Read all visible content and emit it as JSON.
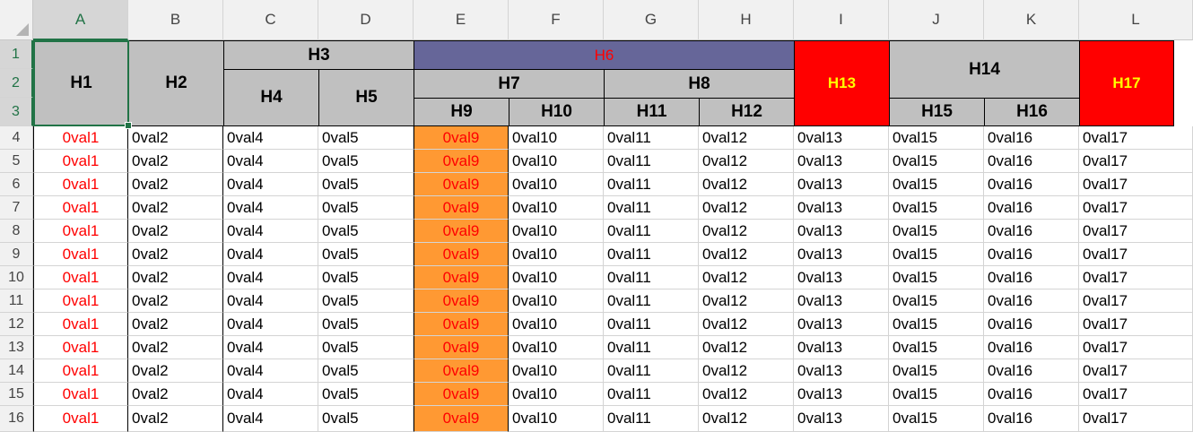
{
  "sheet": {
    "columns": [
      "A",
      "B",
      "C",
      "D",
      "E",
      "F",
      "G",
      "H",
      "I",
      "J",
      "K",
      "L"
    ],
    "rows": [
      "1",
      "2",
      "3",
      "4",
      "5",
      "6",
      "7",
      "8",
      "9",
      "10",
      "11",
      "12",
      "13",
      "14",
      "15",
      "16"
    ],
    "selected_column": "A",
    "selected_rows": [
      "1",
      "2",
      "3"
    ]
  },
  "headers": {
    "h1": "H1",
    "h2": "H2",
    "h3": "H3",
    "h4": "H4",
    "h5": "H5",
    "h6": "H6",
    "h7": "H7",
    "h8": "H8",
    "h9": "H9",
    "h10": "H10",
    "h11": "H11",
    "h12": "H12",
    "h13": "H13",
    "h14": "H14",
    "h15": "H15",
    "h16": "H16",
    "h17": "H17"
  },
  "data_row": [
    "0val1",
    "0val2",
    "0val4",
    "0val5",
    "0val9",
    "0val10",
    "0val11",
    "0val12",
    "0val13",
    "0val15",
    "0val16",
    "0val17"
  ],
  "colors": {
    "header_gray": "#c0c0c0",
    "h6_purple": "#666699",
    "h6_text": "#ff0000",
    "red_header": "#ff0000",
    "red_header_text": "#ffff00",
    "orange_fill": "#ff9933",
    "red_text": "#ff0000",
    "selection_green": "#217346"
  }
}
